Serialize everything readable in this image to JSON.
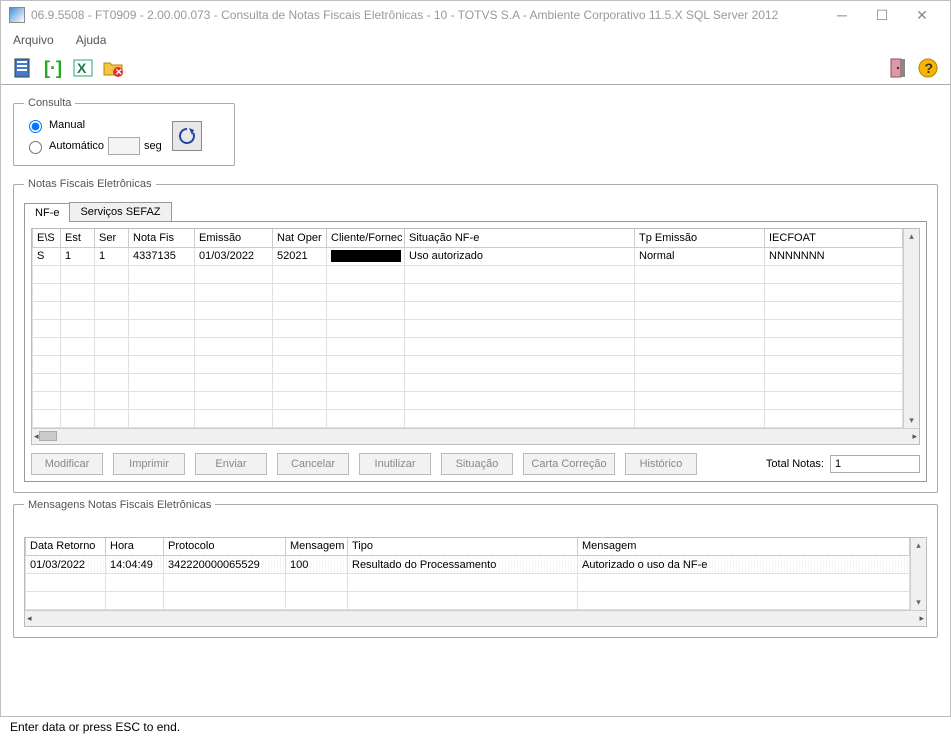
{
  "window": {
    "title": "06.9.5508 - FT0909 - 2.00.00.073 - Consulta de Notas Fiscais Eletrônicas - 10 - TOTVS S.A - Ambiente Corporativo 11.5.X SQL Server 2012"
  },
  "menu": {
    "arquivo": "Arquivo",
    "ajuda": "Ajuda"
  },
  "consulta": {
    "legend": "Consulta",
    "manual": "Manual",
    "automatico": "Automático",
    "seg_label": "seg",
    "seg_value": ""
  },
  "nfe_section": {
    "legend": "Notas Fiscais Eletrônicas",
    "tabs": {
      "nfe": "NF-e",
      "sefaz": "Serviços SEFAZ"
    },
    "columns": {
      "es": "E\\S",
      "est": "Est",
      "ser": "Ser",
      "nota": "Nota Fis",
      "emissao": "Emissão",
      "natoper": "Nat Oper",
      "cliente": "Cliente/Fornec",
      "situacao": "Situação NF-e",
      "tpemissao": "Tp Emissão",
      "iecfoat": "IECFOAT"
    },
    "row": {
      "es": "S",
      "est": "1",
      "ser": "1",
      "nota": "4337135",
      "emissao": "01/03/2022",
      "natoper": "52021",
      "cliente": "",
      "situacao": "Uso autorizado",
      "tpemissao": "Normal",
      "iecfoat": "NNNNNNN"
    },
    "buttons": {
      "modificar": "Modificar",
      "imprimir": "Imprimir",
      "enviar": "Enviar",
      "cancelar": "Cancelar",
      "inutilizar": "Inutilizar",
      "situacao": "Situação",
      "carta": "Carta Correção",
      "historico": "Histórico"
    },
    "total_label": "Total Notas:",
    "total_value": "1"
  },
  "msg_section": {
    "legend": "Mensagens Notas Fiscais Eletrônicas",
    "columns": {
      "data": "Data Retorno",
      "hora": "Hora",
      "protocolo": "Protocolo",
      "mens_num": "Mensagem",
      "tipo": "Tipo",
      "mensagem": "Mensagem"
    },
    "row": {
      "data": "01/03/2022",
      "hora": "14:04:49",
      "protocolo": "342220000065529",
      "mens_num": "100",
      "tipo": "Resultado do Processamento",
      "mensagem": "Autorizado o uso da NF-e"
    }
  },
  "statusbar": "Enter data or press ESC to end."
}
